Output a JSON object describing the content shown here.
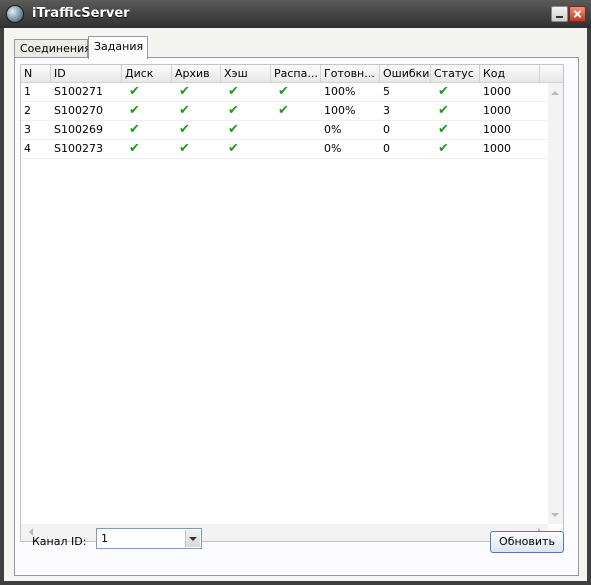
{
  "window": {
    "title": "iTrafficServer"
  },
  "tabs": [
    {
      "label": "Соединения"
    },
    {
      "label": "Задания"
    }
  ],
  "table": {
    "columns": [
      "N",
      "ID",
      "Диск",
      "Архив",
      "Хэш",
      "Распа...",
      "Готовн...",
      "Ошибки",
      "Статус",
      "Код"
    ],
    "rows": [
      {
        "n": "1",
        "id": "S100271",
        "disk": true,
        "archive": true,
        "hash": true,
        "unpack": true,
        "ready": "100%",
        "errors": "5",
        "status": true,
        "code": "1000"
      },
      {
        "n": "2",
        "id": "S100270",
        "disk": true,
        "archive": true,
        "hash": true,
        "unpack": true,
        "ready": "100%",
        "errors": "3",
        "status": true,
        "code": "1000"
      },
      {
        "n": "3",
        "id": "S100269",
        "disk": true,
        "archive": true,
        "hash": true,
        "unpack": false,
        "ready": "0%",
        "errors": "0",
        "status": true,
        "code": "1000"
      },
      {
        "n": "4",
        "id": "S100273",
        "disk": true,
        "archive": true,
        "hash": true,
        "unpack": false,
        "ready": "0%",
        "errors": "0",
        "status": true,
        "code": "1000"
      }
    ],
    "check_glyph": "✔",
    "check_color": "#1f9a1f"
  },
  "channel": {
    "label": "Канал ID:",
    "value": "1"
  },
  "refresh_button": "Обновить"
}
